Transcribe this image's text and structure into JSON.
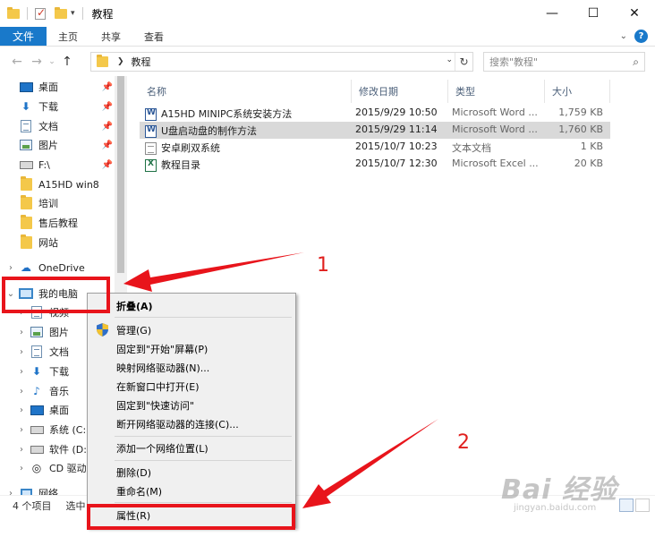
{
  "window": {
    "title": "教程",
    "controls": {
      "minimize": "—",
      "maximize": "☐",
      "close": "✕"
    }
  },
  "ribbon": {
    "file_tab": "文件",
    "tabs": [
      "主页",
      "共享",
      "查看"
    ]
  },
  "address": {
    "breadcrumb": "教程",
    "search_placeholder": "搜索\"教程\""
  },
  "nav_pane": {
    "quick_access": [
      {
        "label": "桌面",
        "icon": "desktop-icon",
        "pinned": true
      },
      {
        "label": "下载",
        "icon": "download-arrow-icon",
        "pinned": true
      },
      {
        "label": "文档",
        "icon": "document-icon",
        "pinned": true
      },
      {
        "label": "图片",
        "icon": "picture-icon",
        "pinned": true
      },
      {
        "label": "F:\\",
        "icon": "drive-icon",
        "pinned": true
      },
      {
        "label": "A15HD  win8",
        "icon": "folder-icon",
        "pinned": false
      },
      {
        "label": "培训",
        "icon": "folder-icon",
        "pinned": false
      },
      {
        "label": "售后教程",
        "icon": "folder-icon",
        "pinned": false
      },
      {
        "label": "网站",
        "icon": "folder-icon",
        "pinned": false
      }
    ],
    "onedrive": "OneDrive",
    "this_pc": "我的电脑",
    "pc_children_partial": "视频",
    "pc_children": [
      {
        "label": "图片",
        "icon": "picture-icon"
      },
      {
        "label": "文档",
        "icon": "document-icon"
      },
      {
        "label": "下载",
        "icon": "download-arrow-icon"
      },
      {
        "label": "音乐",
        "icon": "music-note-icon"
      },
      {
        "label": "桌面",
        "icon": "desktop-icon"
      },
      {
        "label": "系统 (C:)",
        "icon": "drive-icon"
      },
      {
        "label": "软件 (D:)",
        "icon": "drive-icon"
      },
      {
        "label": "CD 驱动器",
        "icon": "cd-drive-icon"
      }
    ],
    "network_partial": "网络"
  },
  "columns": {
    "name": "名称",
    "date": "修改日期",
    "type": "类型",
    "size": "大小"
  },
  "files": [
    {
      "name": "A15HD MINIPC系统安装方法",
      "date": "2015/9/29 10:50",
      "type": "Microsoft Word ...",
      "size": "1,759 KB",
      "icon": "word-icon",
      "selected": false
    },
    {
      "name": "U盘启动盘的制作方法",
      "date": "2015/9/29 11:14",
      "type": "Microsoft Word ...",
      "size": "1,760 KB",
      "icon": "word-icon",
      "selected": true
    },
    {
      "name": "安卓刷双系统",
      "date": "2015/10/7 10:23",
      "type": "文本文档",
      "size": "1 KB",
      "icon": "text-file-icon",
      "selected": false
    },
    {
      "name": "教程目录",
      "date": "2015/10/7 12:30",
      "type": "Microsoft Excel ...",
      "size": "20 KB",
      "icon": "excel-icon",
      "selected": false
    }
  ],
  "status": {
    "count": "4 个项目",
    "selection": "选中"
  },
  "context_menu": {
    "collapse": "折叠(A)",
    "manage": "管理(G)",
    "pin_start": "固定到\"开始\"屏幕(P)",
    "map_drive": "映射网络驱动器(N)...",
    "open_new_window": "在新窗口中打开(E)",
    "pin_quick": "固定到\"快速访问\"",
    "disconnect_drive": "断开网络驱动器的连接(C)...",
    "add_network_location": "添加一个网络位置(L)",
    "delete": "删除(D)",
    "rename": "重命名(M)",
    "properties": "属性(R)"
  },
  "annotations": {
    "step1": "1",
    "step2": "2",
    "color": "#e8141b"
  },
  "watermark": {
    "main": "Bai 经验",
    "sub": "jingyan.baidu.com"
  }
}
